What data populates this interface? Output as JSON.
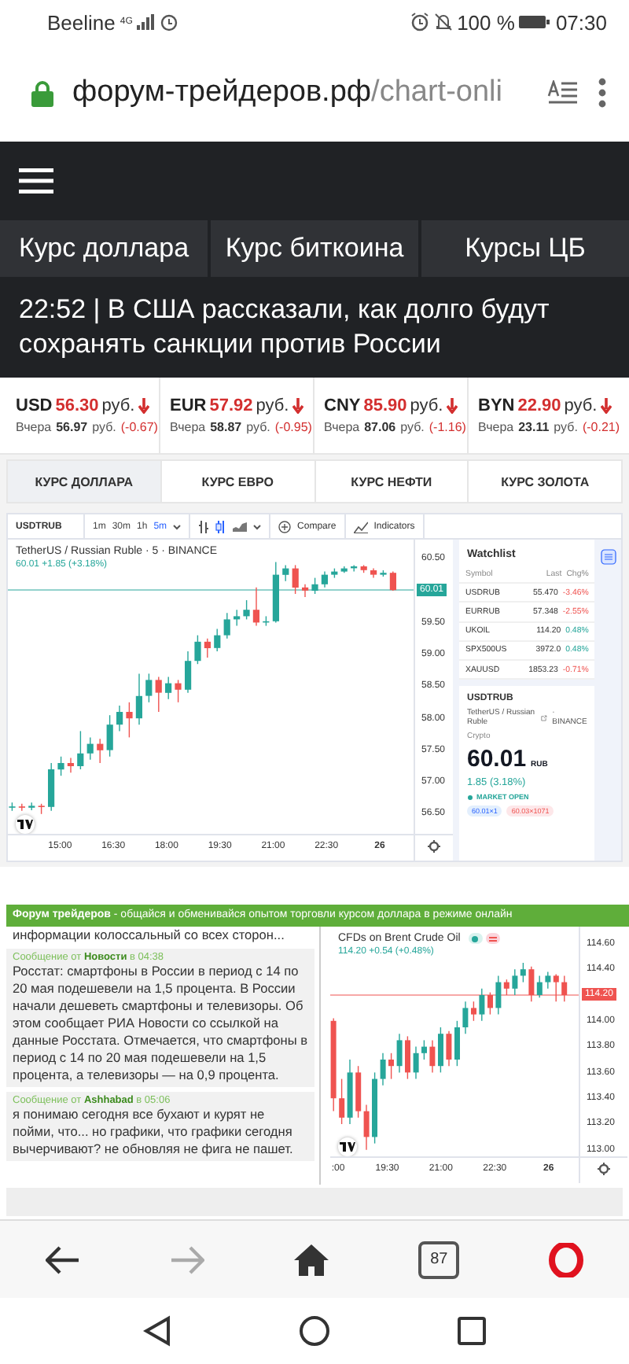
{
  "status_bar": {
    "carrier": "Beeline",
    "network": "4G",
    "battery": "100 %",
    "time": "07:30"
  },
  "address_bar": {
    "domain": "форум-трейдеров.рф",
    "path": "/chart-onli"
  },
  "site_nav": {
    "items": [
      "Курс доллара",
      "Курс биткоина",
      "Курсы ЦБ"
    ]
  },
  "headline": "22:52 | В США рассказали, как долго будут сохранять санкции против России",
  "rates": [
    {
      "code": "USD",
      "price": "56.30",
      "unit": "руб.",
      "falling": true,
      "prev_label": "Вчера",
      "prev": "56.97",
      "prev_unit": "руб.",
      "change": "(-0.67)"
    },
    {
      "code": "EUR",
      "price": "57.92",
      "unit": "руб.",
      "falling": true,
      "prev_label": "Вчера",
      "prev": "58.87",
      "prev_unit": "руб.",
      "change": "(-0.95)"
    },
    {
      "code": "CNY",
      "price": "85.90",
      "unit": "руб.",
      "falling": true,
      "prev_label": "Вчера",
      "prev": "87.06",
      "prev_unit": "руб.",
      "change": "(-1.16)"
    },
    {
      "code": "BYN",
      "price": "22.90",
      "unit": "руб.",
      "falling": true,
      "prev_label": "Вчера",
      "prev": "23.11",
      "prev_unit": "руб.",
      "change": "(-0.21)"
    }
  ],
  "chart_tabs": [
    {
      "label": "КУРС ДОЛЛАРА",
      "selected": true
    },
    {
      "label": "КУРС ЕВРО",
      "selected": false
    },
    {
      "label": "КУРС НЕФТИ",
      "selected": false
    },
    {
      "label": "КУРС ЗОЛОТА",
      "selected": false
    }
  ],
  "usd_widget": {
    "symbol": "USDTRUB",
    "intervals": [
      {
        "label": "1m",
        "selected": false
      },
      {
        "label": "30m",
        "selected": false
      },
      {
        "label": "1h",
        "selected": false
      },
      {
        "label": "5m",
        "selected": true
      }
    ],
    "compare": "Compare",
    "indicators": "Indicators",
    "title": "TetherUS / Russian Ruble · 5 · BINANCE",
    "quote": "60.01  +1.85 (+3.18%)",
    "price_tag": "60.01",
    "chart_data": {
      "type": "candlestick",
      "xlim": [
        13.53,
        26.06
      ],
      "ylim": [
        56.19,
        60.8
      ],
      "ref_lines": [
        {
          "axis": "y",
          "value": 60.01
        }
      ],
      "x": [
        13.65,
        13.925,
        14.2,
        14.475,
        14.75,
        15.025,
        15.3,
        15.575,
        15.85,
        16.125,
        16.4,
        16.675,
        16.95,
        17.225,
        17.5,
        17.775,
        18.05,
        18.325,
        18.6,
        18.875,
        19.15,
        19.425,
        19.7,
        19.975,
        20.25,
        20.525,
        20.8,
        21.075,
        21.35,
        21.625,
        21.9,
        22.175,
        22.45,
        22.725,
        23.0,
        23.275,
        23.55,
        23.825,
        24.1,
        24.375
      ],
      "ohlc": [
        [
          56.6,
          56.68,
          56.55,
          56.62
        ],
        [
          56.62,
          56.66,
          56.55,
          56.6
        ],
        [
          56.6,
          56.68,
          56.56,
          56.63
        ],
        [
          56.63,
          56.66,
          56.5,
          56.61
        ],
        [
          56.61,
          57.3,
          56.55,
          57.2
        ],
        [
          57.2,
          57.4,
          57.1,
          57.3
        ],
        [
          57.3,
          57.38,
          57.15,
          57.25
        ],
        [
          57.25,
          57.8,
          57.2,
          57.45
        ],
        [
          57.45,
          57.7,
          57.35,
          57.6
        ],
        [
          57.6,
          57.68,
          57.3,
          57.5
        ],
        [
          57.5,
          58.05,
          57.4,
          57.9
        ],
        [
          57.9,
          58.2,
          57.8,
          58.1
        ],
        [
          58.1,
          58.25,
          57.7,
          58.0
        ],
        [
          58.0,
          58.7,
          57.9,
          58.35
        ],
        [
          58.35,
          58.7,
          58.25,
          58.6
        ],
        [
          58.6,
          58.65,
          58.1,
          58.4
        ],
        [
          58.4,
          58.65,
          58.3,
          58.55
        ],
        [
          58.55,
          58.6,
          58.25,
          58.45
        ],
        [
          58.45,
          59.05,
          58.4,
          58.9
        ],
        [
          58.9,
          59.3,
          58.85,
          59.2
        ],
        [
          59.2,
          59.25,
          58.95,
          59.1
        ],
        [
          59.1,
          59.4,
          59.05,
          59.3
        ],
        [
          59.3,
          59.65,
          59.25,
          59.55
        ],
        [
          59.55,
          59.7,
          59.45,
          59.6
        ],
        [
          59.6,
          59.85,
          59.55,
          59.7
        ],
        [
          59.7,
          60.05,
          59.45,
          59.5
        ],
        [
          59.5,
          59.6,
          59.45,
          59.52
        ],
        [
          59.52,
          60.45,
          59.5,
          60.25
        ],
        [
          60.25,
          60.4,
          60.15,
          60.35
        ],
        [
          60.35,
          60.4,
          59.95,
          60.05
        ],
        [
          60.05,
          60.1,
          59.9,
          60.0
        ],
        [
          60.0,
          60.2,
          59.95,
          60.1
        ],
        [
          60.1,
          60.3,
          60.05,
          60.25
        ],
        [
          60.25,
          60.35,
          60.2,
          60.3
        ],
        [
          60.3,
          60.38,
          60.28,
          60.35
        ],
        [
          60.35,
          60.4,
          60.3,
          60.38
        ],
        [
          60.38,
          60.4,
          60.28,
          60.32
        ],
        [
          60.32,
          60.35,
          60.2,
          60.25
        ],
        [
          60.25,
          60.32,
          60.22,
          60.28
        ],
        [
          60.28,
          60.3,
          60.0,
          60.01
        ]
      ],
      "yticks": [
        {
          "value": 60.5,
          "label": "60.50"
        },
        {
          "value": 59.5,
          "label": "59.50"
        },
        {
          "value": 59.0,
          "label": "59.00"
        },
        {
          "value": 58.5,
          "label": "58.50"
        },
        {
          "value": 58.0,
          "label": "58.00"
        },
        {
          "value": 57.5,
          "label": "57.50"
        },
        {
          "value": 57.0,
          "label": "57.00"
        },
        {
          "value": 56.5,
          "label": "56.50"
        }
      ],
      "xticks": [
        {
          "value": 15,
          "label": "15:00"
        },
        {
          "value": 16.5,
          "label": "16:30"
        },
        {
          "value": 18,
          "label": "18:00"
        },
        {
          "value": 19.5,
          "label": "19:30"
        },
        {
          "value": 21,
          "label": "21:00"
        },
        {
          "value": 22.5,
          "label": "22:30"
        }
      ]
    },
    "x_day_label": "26",
    "watchlist": {
      "title": "Watchlist",
      "columns": [
        "Symbol",
        "Last",
        "Chg%"
      ],
      "rows": [
        {
          "symbol": "USDRUB",
          "last": "55.470",
          "change": "-3.46%",
          "color": "#ef5350"
        },
        {
          "symbol": "EURRUB",
          "last": "57.348",
          "change": "-2.55%",
          "color": "#ef5350"
        },
        {
          "symbol": "UKOIL",
          "last": "114.20",
          "change": "0.48%",
          "color": "#26a69a"
        },
        {
          "symbol": "SPX500US",
          "last": "3972.0",
          "change": "0.48%",
          "color": "#26a69a"
        },
        {
          "symbol": "XAUUSD",
          "last": "1853.23",
          "change": "-0.71%",
          "color": "#ef5350"
        }
      ]
    },
    "details": {
      "symbol": "USDTRUB",
      "name": "TetherUS / Russian Ruble",
      "exchange": "· BINANCE",
      "type": "Crypto",
      "price": "60.01",
      "currency": "RUB",
      "change": "1.85 (3.18%)",
      "market": "MARKET OPEN",
      "bid": "60.01×1",
      "ask": "60.03×1071"
    }
  },
  "forum": {
    "banner": "**Форум трейдеров** - общайся и обменивайся опытом торговли курсом доллара в режиме онлайн",
    "messages": [
      {
        "kind": "cut",
        "text": "информации колоссальный со всех сторон..."
      },
      {
        "kind": "message",
        "header": "Сообщение от **Новости** в 04:38",
        "text": "Росстат: смартфоны в России в период с 14 по 20 мая подешевели на 1,5 процента. В России начали дешеветь смартфоны и телевизоры. Об этом сообщает РИА Новости со ссылкой на данные Росстата. Отмечается, что смартфоны в период с 14 по 20 мая подешевели на 1,5 процента, а телевизоры — на 0,9 процента."
      },
      {
        "kind": "message",
        "header": "Сообщение от **Ashhabad** в 05:06",
        "text": "я понимаю сегодня все бухают и курят не пойми, что... но графики, что графики сегодня вычерчивают? не обновляя не фига не пашет."
      }
    ]
  },
  "brent_widget": {
    "title": "CFDs on Brent Crude Oil",
    "quote": "114.20  +0.54 (+0.48%)",
    "price_tag": "114.20",
    "chart_data": {
      "type": "candlestick",
      "xlim": [
        17.91,
        26.2
      ],
      "ylim": [
        112.95,
        114.73
      ],
      "ref_lines": [
        {
          "axis": "y",
          "value": 114.2
        }
      ],
      "x": [
        18,
        18.23,
        18.46,
        18.69,
        18.92,
        19.15,
        19.38,
        19.61,
        19.84,
        20.07,
        20.3,
        20.53,
        20.76,
        20.99,
        21.22,
        21.45,
        21.68,
        21.91,
        22.14,
        22.37,
        22.6,
        22.83,
        23.06,
        23.29,
        23.52,
        23.75,
        23.98,
        24.21,
        24.44
      ],
      "ohlc": [
        [
          114.0,
          114.02,
          113.3,
          113.4
        ],
        [
          113.4,
          113.55,
          113.2,
          113.25
        ],
        [
          113.25,
          113.7,
          113.2,
          113.6
        ],
        [
          113.6,
          113.65,
          113.25,
          113.3
        ],
        [
          113.3,
          113.35,
          113.0,
          113.1
        ],
        [
          113.1,
          113.6,
          113.05,
          113.55
        ],
        [
          113.55,
          113.75,
          113.5,
          113.7
        ],
        [
          113.7,
          113.75,
          113.55,
          113.65
        ],
        [
          113.65,
          113.9,
          113.6,
          113.85
        ],
        [
          113.85,
          113.88,
          113.55,
          113.6
        ],
        [
          113.6,
          113.8,
          113.55,
          113.75
        ],
        [
          113.75,
          113.85,
          113.7,
          113.8
        ],
        [
          113.8,
          113.85,
          113.6,
          113.65
        ],
        [
          113.65,
          113.95,
          113.6,
          113.9
        ],
        [
          113.9,
          113.92,
          113.65,
          113.7
        ],
        [
          113.7,
          114.0,
          113.65,
          113.95
        ],
        [
          113.95,
          114.15,
          113.9,
          114.1
        ],
        [
          114.1,
          114.15,
          114.0,
          114.05
        ],
        [
          114.05,
          114.25,
          114.0,
          114.2
        ],
        [
          114.2,
          114.22,
          114.05,
          114.1
        ],
        [
          114.1,
          114.35,
          114.05,
          114.3
        ],
        [
          114.3,
          114.32,
          114.2,
          114.25
        ],
        [
          114.25,
          114.4,
          114.2,
          114.35
        ],
        [
          114.35,
          114.45,
          114.3,
          114.4
        ],
        [
          114.4,
          114.42,
          114.15,
          114.2
        ],
        [
          114.2,
          114.35,
          114.18,
          114.3
        ],
        [
          114.3,
          114.38,
          114.25,
          114.35
        ],
        [
          114.35,
          114.36,
          114.15,
          114.3
        ],
        [
          114.3,
          114.35,
          114.15,
          114.2
        ]
      ],
      "yticks": [
        {
          "value": 114.6,
          "label": "114.60"
        },
        {
          "value": 114.4,
          "label": "114.40"
        },
        {
          "value": 114.0,
          "label": "114.00"
        },
        {
          "value": 113.8,
          "label": "113.80"
        },
        {
          "value": 113.6,
          "label": "113.60"
        },
        {
          "value": 113.4,
          "label": "113.40"
        },
        {
          "value": 113.2,
          "label": "113.20"
        },
        {
          "value": 113.0,
          "label": "113.00"
        }
      ],
      "xticks": [
        {
          "value": 19.5,
          "label": "19:30"
        },
        {
          "value": 21,
          "label": "21:00"
        },
        {
          "value": 22.5,
          "label": "22:30"
        }
      ]
    },
    "x_cut_label": ":00",
    "x_day_label": "26"
  },
  "browser_toolbar": {
    "tab_count": "87"
  }
}
